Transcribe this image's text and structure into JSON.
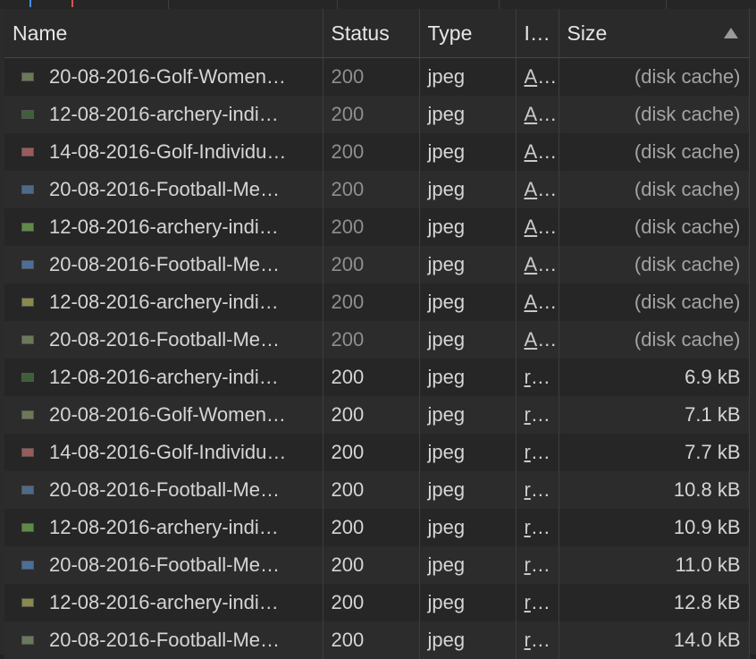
{
  "columns": {
    "name": "Name",
    "status": "Status",
    "type": "Type",
    "initiator": "I…",
    "size": "Size"
  },
  "sort": {
    "column": "Size",
    "direction": "ascending"
  },
  "rows": [
    {
      "name": "20-08-2016-Golf-Women…",
      "status": "200",
      "type": "jpeg",
      "initiator": "A…",
      "size": "(disk cache)",
      "thumb": "#6b7a55"
    },
    {
      "name": "12-08-2016-archery-indi…",
      "status": "200",
      "type": "jpeg",
      "initiator": "A…",
      "size": "(disk cache)",
      "thumb": "#3f5f3a"
    },
    {
      "name": "14-08-2016-Golf-Individu…",
      "status": "200",
      "type": "jpeg",
      "initiator": "A…",
      "size": "(disk cache)",
      "thumb": "#9c5a5a"
    },
    {
      "name": "20-08-2016-Football-Me…",
      "status": "200",
      "type": "jpeg",
      "initiator": "A…",
      "size": "(disk cache)",
      "thumb": "#4d6a8a"
    },
    {
      "name": "12-08-2016-archery-indi…",
      "status": "200",
      "type": "jpeg",
      "initiator": "A…",
      "size": "(disk cache)",
      "thumb": "#5f8a4a"
    },
    {
      "name": "20-08-2016-Football-Me…",
      "status": "200",
      "type": "jpeg",
      "initiator": "A…",
      "size": "(disk cache)",
      "thumb": "#4a6f9a"
    },
    {
      "name": "12-08-2016-archery-indi…",
      "status": "200",
      "type": "jpeg",
      "initiator": "A…",
      "size": "(disk cache)",
      "thumb": "#8a8a4a"
    },
    {
      "name": "20-08-2016-Football-Me…",
      "status": "200",
      "type": "jpeg",
      "initiator": "A…",
      "size": "(disk cache)",
      "thumb": "#6a7a5a"
    },
    {
      "name": "12-08-2016-archery-indi…",
      "status": "200",
      "type": "jpeg",
      "initiator": "r…",
      "size": "6.9 kB",
      "thumb": "#3f5f3a"
    },
    {
      "name": "20-08-2016-Golf-Women…",
      "status": "200",
      "type": "jpeg",
      "initiator": "r…",
      "size": "7.1 kB",
      "thumb": "#6b7a55"
    },
    {
      "name": "14-08-2016-Golf-Individu…",
      "status": "200",
      "type": "jpeg",
      "initiator": "r…",
      "size": "7.7 kB",
      "thumb": "#9c5a5a"
    },
    {
      "name": "20-08-2016-Football-Me…",
      "status": "200",
      "type": "jpeg",
      "initiator": "r…",
      "size": "10.8 kB",
      "thumb": "#4d6a8a"
    },
    {
      "name": "12-08-2016-archery-indi…",
      "status": "200",
      "type": "jpeg",
      "initiator": "r…",
      "size": "10.9 kB",
      "thumb": "#5f8a4a"
    },
    {
      "name": "20-08-2016-Football-Me…",
      "status": "200",
      "type": "jpeg",
      "initiator": "r…",
      "size": "11.0 kB",
      "thumb": "#4a6f9a"
    },
    {
      "name": "12-08-2016-archery-indi…",
      "status": "200",
      "type": "jpeg",
      "initiator": "r…",
      "size": "12.8 kB",
      "thumb": "#8a8a4a"
    },
    {
      "name": "20-08-2016-Football-Me…",
      "status": "200",
      "type": "jpeg",
      "initiator": "r…",
      "size": "14.0 kB",
      "thumb": "#6a7a5a"
    }
  ]
}
